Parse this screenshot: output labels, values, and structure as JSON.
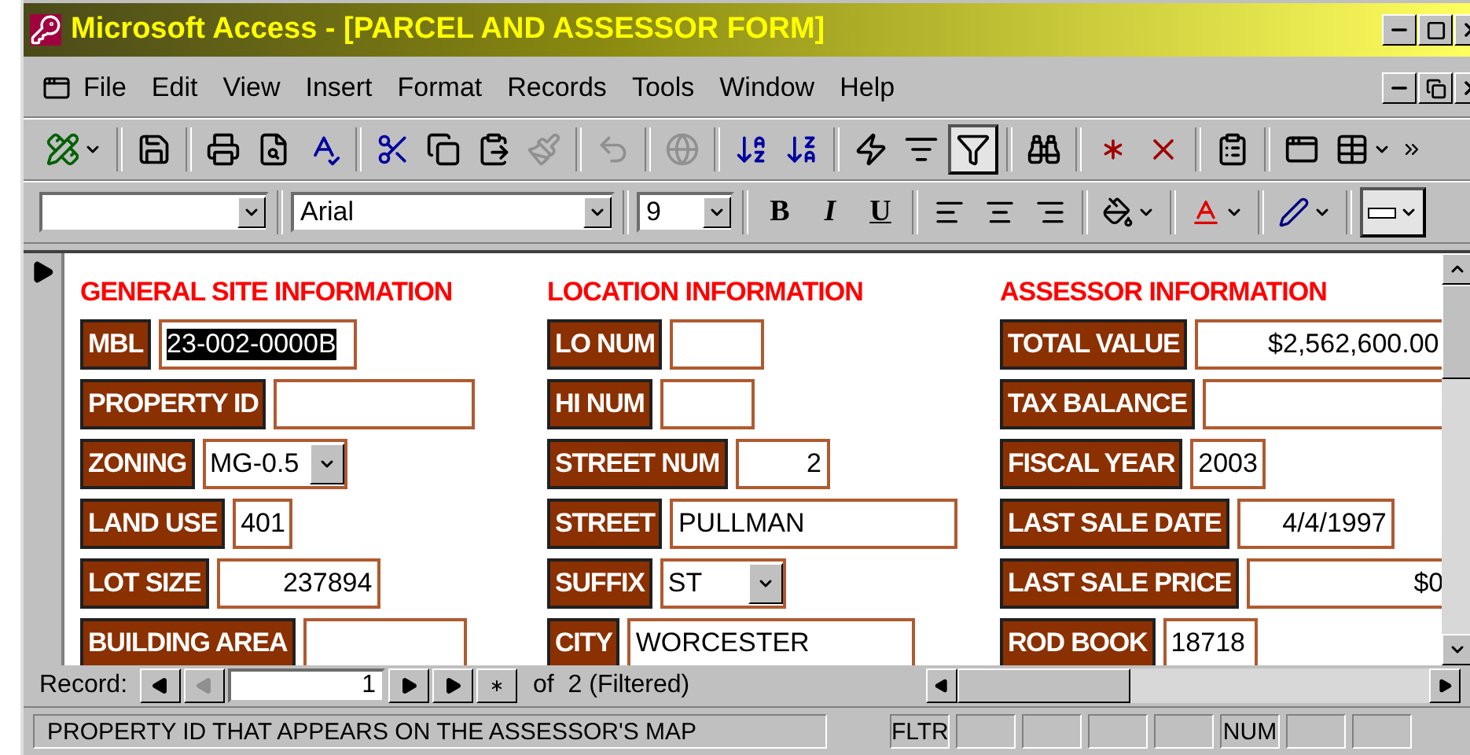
{
  "window": {
    "title": "Microsoft Access - [PARCEL AND ASSESSOR FORM]"
  },
  "menu": [
    "File",
    "Edit",
    "View",
    "Insert",
    "Format",
    "Records",
    "Tools",
    "Window",
    "Help"
  ],
  "toolbar": [
    {
      "kind": "design",
      "disabled": false,
      "pressed": false
    },
    {
      "kind": "separator"
    },
    {
      "kind": "save",
      "disabled": false,
      "pressed": false
    },
    {
      "kind": "separator"
    },
    {
      "kind": "print",
      "disabled": false,
      "pressed": false
    },
    {
      "kind": "preview",
      "disabled": false,
      "pressed": false
    },
    {
      "kind": "spelling",
      "disabled": false,
      "pressed": false
    },
    {
      "kind": "separator"
    },
    {
      "kind": "cut",
      "disabled": false,
      "pressed": false
    },
    {
      "kind": "copy",
      "disabled": false,
      "pressed": false
    },
    {
      "kind": "paste",
      "disabled": false,
      "pressed": false
    },
    {
      "kind": "painter",
      "disabled": true,
      "pressed": false
    },
    {
      "kind": "separator"
    },
    {
      "kind": "undo",
      "disabled": true,
      "pressed": false
    },
    {
      "kind": "separator"
    },
    {
      "kind": "hyperlink",
      "disabled": true,
      "pressed": false
    },
    {
      "kind": "separator"
    },
    {
      "kind": "sortasc",
      "disabled": false,
      "pressed": false
    },
    {
      "kind": "sortdesc",
      "disabled": false,
      "pressed": false
    },
    {
      "kind": "separator"
    },
    {
      "kind": "filtersel",
      "disabled": false,
      "pressed": false
    },
    {
      "kind": "filterform",
      "disabled": false,
      "pressed": false
    },
    {
      "kind": "filter",
      "disabled": false,
      "pressed": true
    },
    {
      "kind": "separator"
    },
    {
      "kind": "find",
      "disabled": false,
      "pressed": false
    },
    {
      "kind": "separator"
    },
    {
      "kind": "newrecord",
      "disabled": false,
      "pressed": false
    },
    {
      "kind": "deleterecord",
      "disabled": false,
      "pressed": false
    },
    {
      "kind": "separator"
    },
    {
      "kind": "properties",
      "disabled": false,
      "pressed": false
    },
    {
      "kind": "separator"
    },
    {
      "kind": "dbwindow",
      "disabled": false,
      "pressed": false
    },
    {
      "kind": "newobject",
      "disabled": false,
      "pressed": false
    }
  ],
  "format_toolbar": {
    "font": "Arial",
    "size": "9",
    "bold": "B",
    "italic": "I",
    "underline": "U"
  },
  "sections": [
    {
      "title": "GENERAL SITE INFORMATION",
      "fields": [
        {
          "label": "MBL",
          "value": "23-002-0000B",
          "kind": "text",
          "right_aligned": false,
          "text_selected": true
        },
        {
          "label": "PROPERTY ID",
          "kind": "text"
        },
        {
          "label": "ZONING",
          "value": "MG-0.5",
          "kind": "combo"
        },
        {
          "label": "LAND USE",
          "value": "401",
          "kind": "text",
          "right_aligned": false,
          "text_selected": false
        },
        {
          "label": "LOT SIZE",
          "value": "237894",
          "kind": "text",
          "right_aligned": true,
          "text_selected": false
        },
        {
          "label": "BUILDING AREA",
          "kind": "text"
        }
      ]
    },
    {
      "title": "LOCATION INFORMATION",
      "fields": [
        {
          "label": "LO NUM",
          "kind": "text"
        },
        {
          "label": "HI NUM",
          "kind": "text"
        },
        {
          "label": "STREET NUM",
          "value": "2",
          "kind": "text",
          "right_aligned": true,
          "text_selected": false
        },
        {
          "label": "STREET",
          "value": "PULLMAN",
          "kind": "text",
          "right_aligned": false,
          "text_selected": false
        },
        {
          "label": "SUFFIX",
          "value": "ST",
          "kind": "combo"
        },
        {
          "label": "CITY",
          "value": "WORCESTER",
          "kind": "text",
          "right_aligned": false,
          "text_selected": false
        }
      ]
    },
    {
      "title": "ASSESSOR INFORMATION",
      "fields": [
        {
          "label": "TOTAL VALUE",
          "value": "$2,562,600.00",
          "kind": "text",
          "right_aligned": true,
          "text_selected": false
        },
        {
          "label": "TAX BALANCE",
          "kind": "text"
        },
        {
          "label": "FISCAL YEAR",
          "value": "2003",
          "kind": "text",
          "right_aligned": false,
          "text_selected": false
        },
        {
          "label": "LAST SALE DATE",
          "value": "4/4/1997",
          "kind": "text",
          "right_aligned": true,
          "text_selected": false
        },
        {
          "label": "LAST SALE PRICE",
          "value": "$0",
          "kind": "text",
          "right_aligned": true,
          "text_selected": false
        },
        {
          "label": "ROD BOOK",
          "value": "18718",
          "kind": "text",
          "right_aligned": false,
          "text_selected": false
        }
      ]
    }
  ],
  "record_nav": {
    "label": "Record:",
    "current": "1",
    "total": "of  2 (Filtered)"
  },
  "status_bar": {
    "message": "PROPERTY ID THAT APPEARS ON THE ASSESSOR'S MAP",
    "indicators": [
      "FLTR",
      "NUM"
    ]
  }
}
